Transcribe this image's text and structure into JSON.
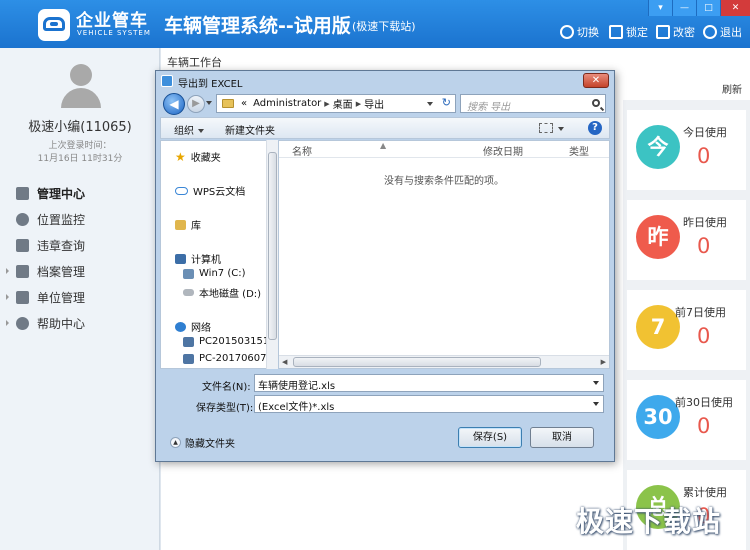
{
  "header": {
    "brand_cn": "企业管车",
    "brand_en": "VEHICLE SYSTEM",
    "title": "车辆管理系统--试用版",
    "title_sub": "(极速下载站)",
    "actions": [
      {
        "label": "切换",
        "icon": "switch-icon"
      },
      {
        "label": "锁定",
        "icon": "lock-icon"
      },
      {
        "label": "改密",
        "icon": "edit-password-icon"
      },
      {
        "label": "退出",
        "icon": "power-icon"
      }
    ],
    "window_buttons": [
      "▾",
      "—",
      "□",
      "✕"
    ]
  },
  "sidebar": {
    "user_name": "极速小编(11065)",
    "last_login_label": "上次登录时间：",
    "last_login_time": "11月16日 11时31分",
    "menu": [
      {
        "label": "管理中心",
        "icon": "monitor-icon"
      },
      {
        "label": "位置监控",
        "icon": "steering-icon"
      },
      {
        "label": "违章查询",
        "icon": "police-icon"
      },
      {
        "label": "档案管理",
        "icon": "archive-icon"
      },
      {
        "label": "单位管理",
        "icon": "chart-icon"
      },
      {
        "label": "帮助中心",
        "icon": "gear-icon"
      }
    ]
  },
  "main": {
    "tab": "车辆工作台",
    "refresh": "刷新",
    "stats": [
      {
        "badge": "今",
        "label": "今日使用",
        "value": "0",
        "color": "#3cc3c3"
      },
      {
        "badge": "昨",
        "label": "昨日使用",
        "value": "0",
        "color": "#ef5b4c"
      },
      {
        "badge": "7",
        "label": "前7日使用",
        "value": "0",
        "color": "#f1c232"
      },
      {
        "badge": "30",
        "label": "前30日使用",
        "value": "0",
        "color": "#3ea9ec"
      },
      {
        "badge": "总",
        "label": "累计使用",
        "value": "0",
        "color": "#8bc34a"
      }
    ]
  },
  "dialog": {
    "title": "导出到 EXCEL",
    "close": "✕",
    "back": "◀",
    "forward": "▶",
    "address": {
      "prefix": "«",
      "segments": [
        "Administrator",
        "桌面",
        "导出"
      ],
      "refresh": "↻"
    },
    "search_placeholder": "搜索 导出",
    "toolbar": {
      "organize": "组织",
      "new_folder": "新建文件夹",
      "help": "?"
    },
    "nav": {
      "favorites": "收藏夹",
      "wps": "WPS云文档",
      "library": "库",
      "computer": "计算机",
      "drive_c": "Win7 (C:)",
      "drive_d": "本地磁盘 (D:)",
      "network": "网络",
      "host1": "PC20150315153",
      "host2": "PC-20170607W"
    },
    "columns": [
      "名称",
      "修改日期",
      "类型"
    ],
    "empty_message": "没有与搜索条件匹配的项。",
    "filename_label": "文件名(N):",
    "filename_value": "车辆使用登记.xls",
    "filetype_label": "保存类型(T):",
    "filetype_value": "(Excel文件)*.xls",
    "hide_folders": "隐藏文件夹",
    "save_button": "保存(S)",
    "cancel_button": "取消"
  },
  "watermark": "极速下载站"
}
